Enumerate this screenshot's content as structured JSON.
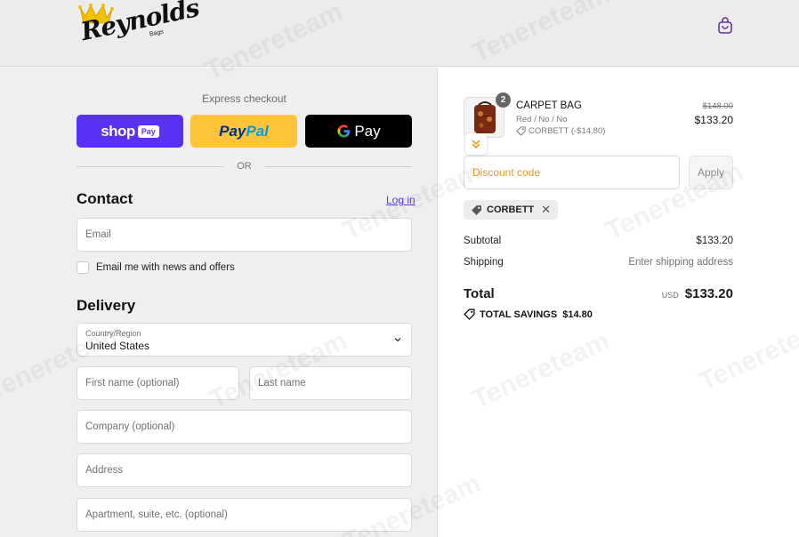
{
  "brand": {
    "script": "Reynolds",
    "sub": "Bags"
  },
  "express": {
    "title": "Express checkout",
    "shop_label": "shop",
    "shop_pill": "Pay",
    "paypal_a": "Pay",
    "paypal_b": "Pal",
    "gpay_label": "Pay",
    "or_text": "OR"
  },
  "contact": {
    "title": "Contact",
    "login_link": "Log in",
    "email_placeholder": "Email",
    "newsletter_label": "Email me with news and offers"
  },
  "delivery": {
    "title": "Delivery",
    "country_label": "Country/Region",
    "country_value": "United States",
    "first_name_placeholder": "First name (optional)",
    "last_name_placeholder": "Last name",
    "company_placeholder": "Company (optional)",
    "address_placeholder": "Address",
    "apartment_placeholder": "Apartment, suite, etc. (optional)"
  },
  "order": {
    "item": {
      "quantity": "2",
      "name": "CARPET BAG",
      "variant": "Red / No / No",
      "discount": "CORBETT (-$14.80)",
      "price_original": "$148.00",
      "price_final": "$133.20"
    },
    "discount_placeholder": "Discount code",
    "apply_label": "Apply",
    "applied_code": "CORBETT",
    "subtotal_label": "Subtotal",
    "subtotal_value": "$133.20",
    "shipping_label": "Shipping",
    "shipping_value": "Enter shipping address",
    "total_label": "Total",
    "currency": "USD",
    "total_value": "$133.20",
    "savings_label": "TOTAL SAVINGS",
    "savings_value": "$14.80"
  },
  "watermark_text": "Tenereteam",
  "colors": {
    "shop_pay": "#5a31f4",
    "paypal": "#ffc439",
    "gpay": "#000000",
    "link": "#5a31f4",
    "discount_placeholder": "#e0a022",
    "crown": "#f2c200"
  }
}
